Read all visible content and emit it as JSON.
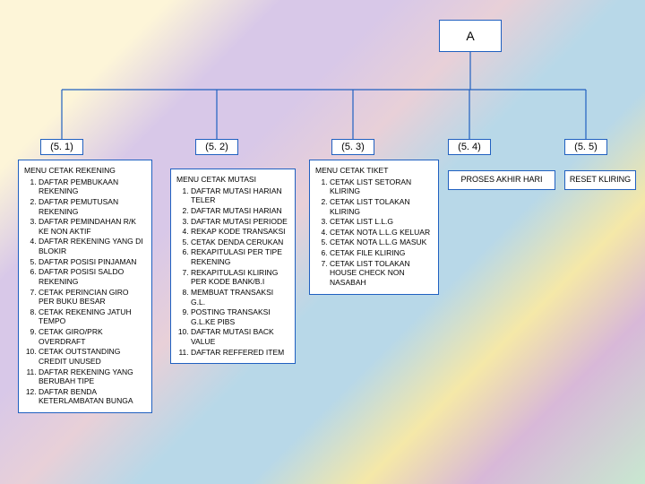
{
  "root": {
    "label": "A"
  },
  "nodes": {
    "n51": {
      "label": "(5. 1)"
    },
    "n52": {
      "label": "(5. 2)"
    },
    "n53": {
      "label": "(5. 3)"
    },
    "n54": {
      "label": "(5. 4)"
    },
    "n55": {
      "label": "(5. 5)"
    }
  },
  "panels": {
    "p51": {
      "title": "MENU CETAK REKENING",
      "items": [
        "DAFTAR PEMBUKAAN REKENING",
        "DAFTAR PEMUTUSAN REKENING",
        "DAFTAR PEMINDAHAN R/K KE NON AKTIF",
        "DAFTAR REKENING YANG DI BLOKIR",
        "DAFTAR POSISI PINJAMAN",
        "DAFTAR POSISI SALDO REKENING",
        "CETAK PERINCIAN GIRO PER BUKU BESAR",
        "CETAK REKENING JATUH TEMPO",
        "CETAK GIRO/PRK OVERDRAFT",
        "CETAK OUTSTANDING CREDIT UNUSED",
        "DAFTAR REKENING YANG BERUBAH TIPE",
        "DAFTAR BENDA KETERLAMBATAN BUNGA"
      ]
    },
    "p52": {
      "title": "MENU CETAK MUTASI",
      "items": [
        "DAFTAR MUTASI HARIAN TELER",
        "DAFTAR MUTASI HARIAN",
        "DAFTAR MUTASI PERIODE",
        "REKAP KODE TRANSAKSI",
        "CETAK DENDA CERUKAN",
        "REKAPITULASI PER TIPE  REKENING",
        "REKAPITULASI KLIRING PER KODE BANK/B.I",
        "MEMBUAT TRANSAKSI G.L.",
        "POSTING TRANSAKSI G.L.KE PIBS",
        "DAFTAR MUTASI BACK VALUE",
        "DAFTAR REFFERED ITEM"
      ]
    },
    "p53": {
      "title": "MENU CETAK TIKET",
      "items": [
        "CETAK LIST SETORAN KLIRING",
        "CETAK LIST TOLAKAN KLIRING",
        "CETAK LIST L.L.G",
        "CETAK NOTA L.L.G KELUAR",
        "CETAK NOTA L.L.G MASUK",
        "CETAK FILE KLIRING",
        "CETAK LIST TOLAKAN HOUSE CHECK NON NASABAH"
      ]
    },
    "p54": {
      "title": "PROSES AKHIR HARI"
    },
    "p55": {
      "title": "RESET KLIRING"
    }
  }
}
